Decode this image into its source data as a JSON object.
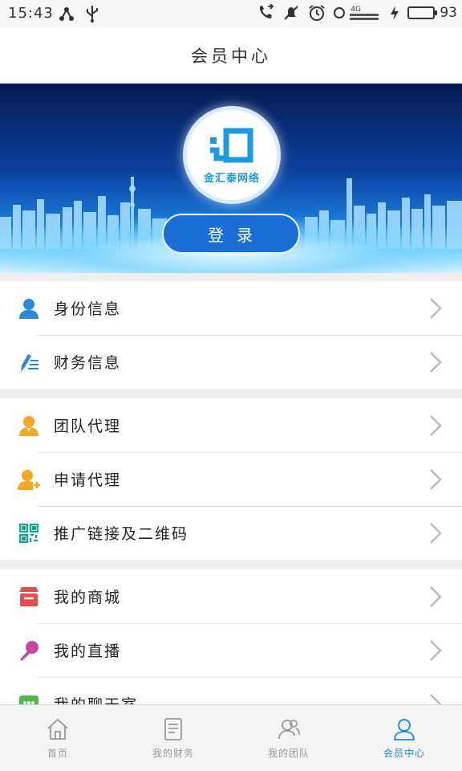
{
  "status_bar": {
    "time": "15:43",
    "battery_percent": "93",
    "battery_level": 0.93,
    "network_label": "4G",
    "icons_left": [
      "network-share-icon",
      "usb-icon"
    ],
    "icons_right": [
      "call-forward-icon",
      "mute-icon",
      "alarm-icon",
      "signal-icon",
      "charging-icon",
      "battery-icon"
    ]
  },
  "header": {
    "title": "会员中心"
  },
  "banner": {
    "logo_text": "金汇泰网络",
    "login_label": "登录"
  },
  "menu": {
    "groups": [
      {
        "items": [
          {
            "label": "身份信息",
            "icon": "user-icon",
            "color": "#2a8ad8"
          },
          {
            "label": "财务信息",
            "icon": "pen-list-icon",
            "color": "#2a8ad8"
          }
        ]
      },
      {
        "items": [
          {
            "label": "团队代理",
            "icon": "agent-icon",
            "color": "#f5a623"
          },
          {
            "label": "申请代理",
            "icon": "add-agent-icon",
            "color": "#f5a623"
          },
          {
            "label": "推广链接及二维码",
            "icon": "qrcode-icon",
            "color": "#1aa38c"
          }
        ]
      },
      {
        "items": [
          {
            "label": "我的商城",
            "icon": "shop-icon",
            "color": "#e54d4d"
          },
          {
            "label": "我的直播",
            "icon": "microphone-icon",
            "color": "#c8479e"
          },
          {
            "label": "我的聊天室",
            "icon": "chat-icon",
            "color": "#4cb84c"
          }
        ]
      }
    ]
  },
  "tabbar": {
    "tabs": [
      {
        "label": "首页",
        "icon": "home-icon",
        "active": false
      },
      {
        "label": "我的财务",
        "icon": "document-icon",
        "active": false
      },
      {
        "label": "我的团队",
        "icon": "team-icon",
        "active": false
      },
      {
        "label": "会员中心",
        "icon": "member-icon",
        "active": true
      }
    ],
    "active_color": "#1a8ad8",
    "inactive_color": "#999999"
  }
}
